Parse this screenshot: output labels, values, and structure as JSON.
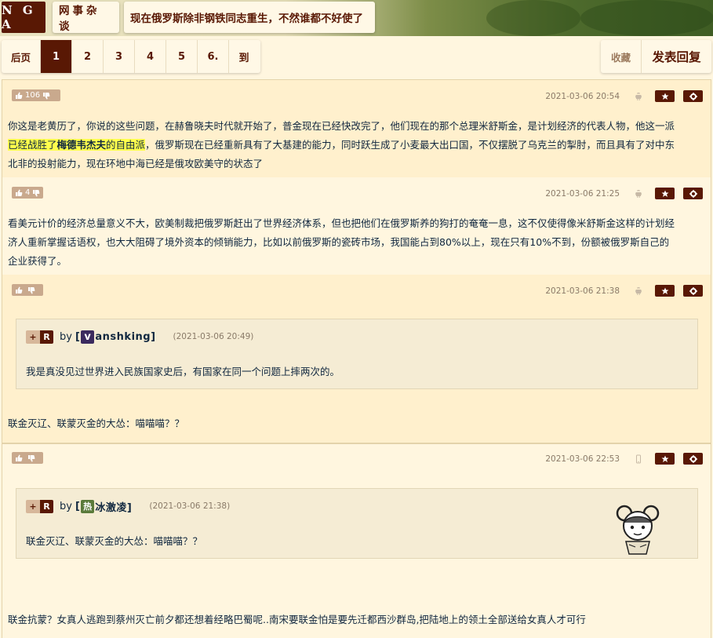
{
  "header": {
    "logo": "N G A",
    "forum": "网事杂谈",
    "topic": "现在俄罗斯除非钢铁同志重生，不然谁都不好使了"
  },
  "pager": {
    "first": "后页",
    "pages": [
      "1",
      "2",
      "3",
      "4",
      "5",
      "6."
    ],
    "current": "1",
    "goto": "到"
  },
  "actions": {
    "favorite": "收藏",
    "reply": "发表回复"
  },
  "colors": {
    "brand": "#591804",
    "highlight": "#ffff4d",
    "background": "#fff6df"
  },
  "posts": [
    {
      "votes": "106",
      "time": "2021-03-06 20:54",
      "device": "android-icon",
      "text_a": "你这是老黄历了，你说的这些问题，在赫鲁晓夫时代就开始了，普金现在已经快改完了，他们现在的那个总理米舒斯金，是计划经济的代表人物，他这一派",
      "hl_pre": "已经战胜了",
      "hl_bold": "梅德韦杰夫",
      "hl_post": "的自由派",
      "text_b": "，俄罗斯现在已经重新具有了大基建的能力，同时跃生成了小麦最大出口国，不仅摆脱了乌克兰的掣肘，而且具有了对中东",
      "text_c": "北非的投射能力，现在环地中海已经是俄攻欧美守的状态了"
    },
    {
      "votes": "4",
      "time": "2021-03-06 21:25",
      "device": "android-icon",
      "line1": "看美元计价的经济总量意义不大，欧美制裁把俄罗斯赶出了世界经济体系，但也把他们在俄罗斯养的狗打的奄奄一息，这不仅使得像米舒斯金这样的计划经",
      "line2": "济人重新掌握话语权，也大大阻碍了境外资本的倾销能力，比如以前俄罗斯的瓷砖市场，我国能占到80%以上，现在只有10%不到，份额被俄罗斯自己的",
      "line3": "企业获得了。"
    },
    {
      "votes": "",
      "time": "2021-03-06 21:38",
      "device": "android-icon",
      "quote": {
        "plus": "+",
        "r": "R",
        "by": "by",
        "user_prefix": "[",
        "user_icon": "v",
        "user_name": "anshking]",
        "time": "(2021-03-06 20:49)",
        "text": "我是真没见过世界进入民族国家史后，有国家在同一个问题上摔两次的。"
      },
      "text": "联金灭辽、联蒙灭金的大怂：喵喵喵？？"
    },
    {
      "votes": "",
      "time": "2021-03-06 22:53",
      "device": "phone-icon",
      "quote": {
        "plus": "+",
        "r": "R",
        "by": "by",
        "user_prefix": "[",
        "user_icon": "热",
        "user_name": "冰激凌]",
        "time": "(2021-03-06 21:38)",
        "text": "联金灭辽、联蒙灭金的大怂：喵喵喵？？"
      },
      "text": "联金抗蒙？女真人逃跑到蔡州灭亡前夕都还想着经略巴蜀呢..南宋要联金怕是要先迁都西沙群岛,把陆地上的领土全部送给女真人才可行"
    }
  ]
}
